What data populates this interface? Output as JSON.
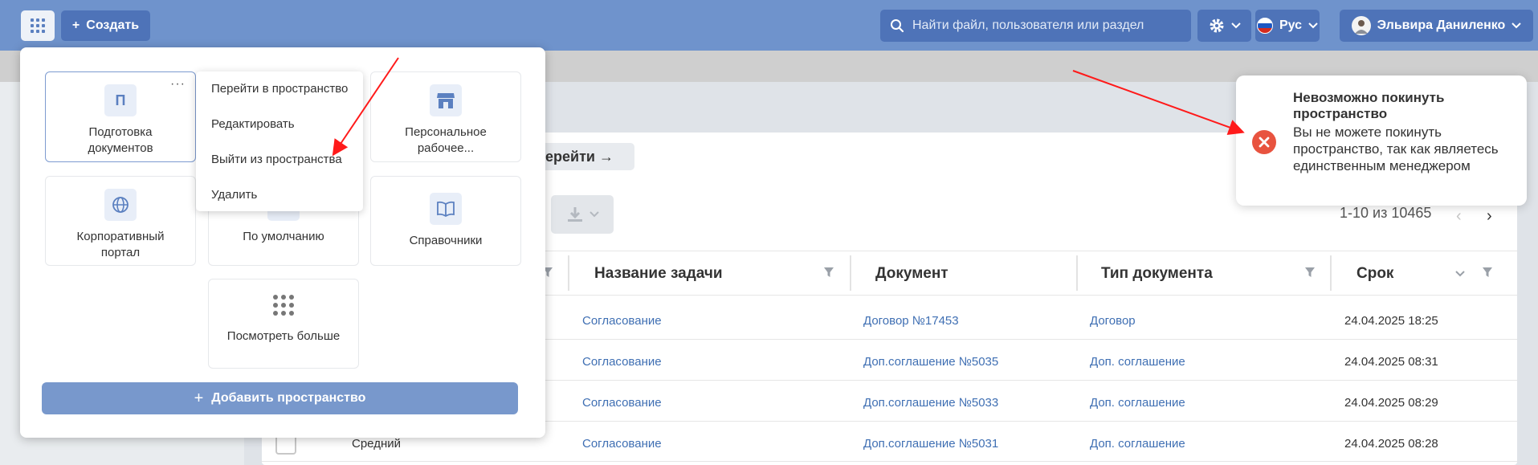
{
  "topbar": {
    "create_label": "Создать",
    "search_placeholder": "Найти файл, пользователя или раздел",
    "language": "Рус",
    "user_name": "Эльвира Даниленко"
  },
  "popup": {
    "tiles": [
      {
        "icon_text": "П",
        "label": "Подготовка документов",
        "icon": "letter-icon"
      },
      {
        "label": "Персональное рабочее...",
        "icon": "store-icon"
      },
      {
        "label": "Корпоративный портал",
        "icon": "globe-icon"
      },
      {
        "label": "По умолчанию",
        "icon": "default-icon"
      },
      {
        "label": "Справочники",
        "icon": "book-icon"
      },
      {
        "label": "Посмотреть больше",
        "icon": "grid-icon"
      }
    ],
    "add_space_label": "Добавить пространство"
  },
  "context_menu": {
    "items": [
      "Перейти в пространство",
      "Редактировать",
      "Выйти из пространства",
      "Удалить"
    ]
  },
  "toast": {
    "title": "Невозможно покинуть пространство",
    "message": "Вы не можете покинуть пространство, так как являетесь единственным менеджером"
  },
  "page": {
    "goto_label": "Перейти →",
    "pagination": "1-10 из 10465",
    "columns": [
      "Название задачи",
      "Документ",
      "Тип документа",
      "Срок"
    ],
    "rows": [
      {
        "task": "Согласование",
        "document": "Договор №17453",
        "doc_type": "Договор",
        "deadline": "24.04.2025 18:25"
      },
      {
        "task": "Согласование",
        "document": "Доп.соглашение №5035",
        "doc_type": "Доп. соглашение",
        "deadline": "24.04.2025 08:31"
      },
      {
        "task": "Согласование",
        "document": "Доп.соглашение №5033",
        "doc_type": "Доп. соглашение",
        "deadline": "24.04.2025 08:29"
      },
      {
        "priority": "Средний",
        "task": "Согласование",
        "document": "Доп.соглашение №5031",
        "doc_type": "Доп. соглашение",
        "deadline": "24.04.2025 08:28"
      }
    ]
  },
  "colors": {
    "topbar": "#6f93cc",
    "button_dark": "#4e73b8",
    "link": "#3f6fb3",
    "error": "#e8533f",
    "annotation_arrow": "#ff1a1a"
  }
}
